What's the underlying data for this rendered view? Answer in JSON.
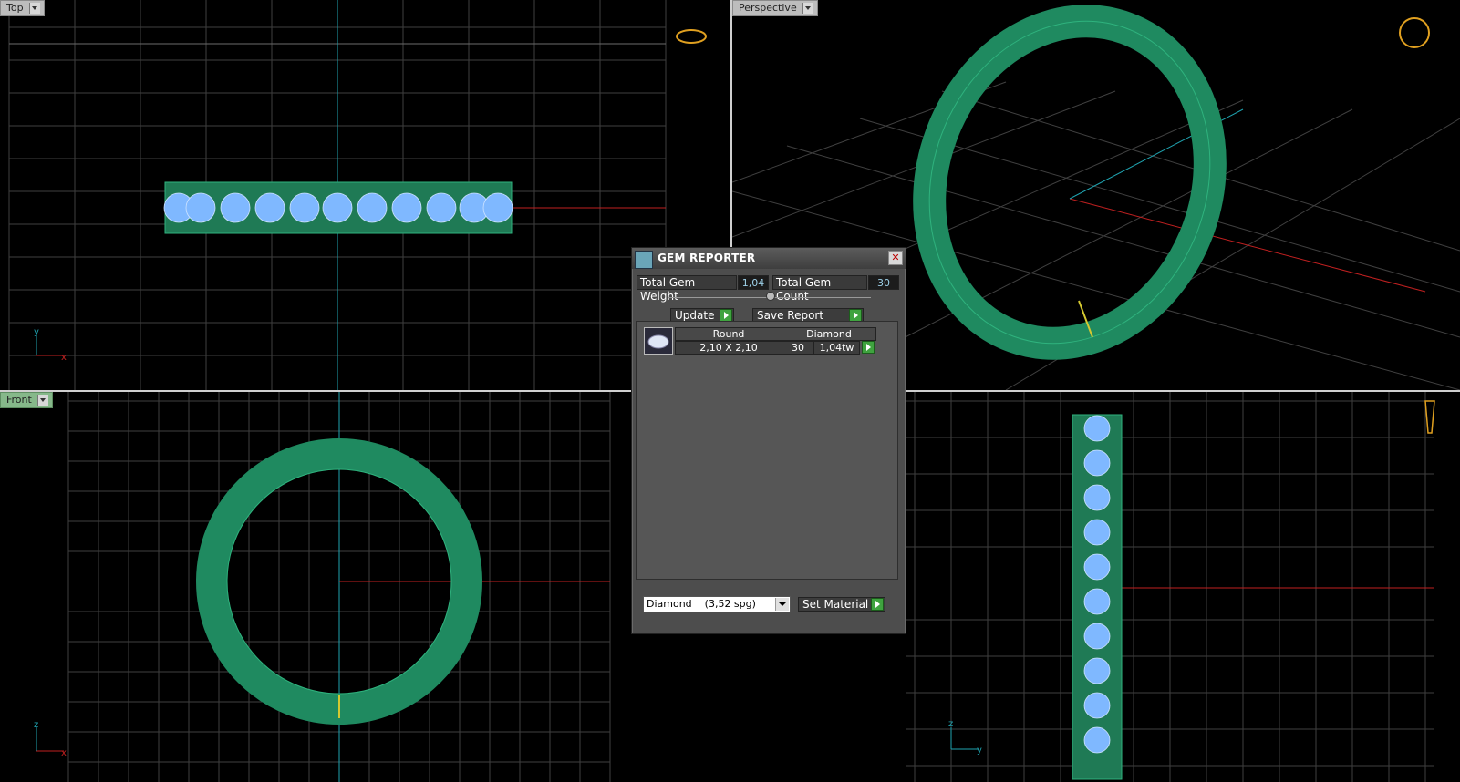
{
  "viewports": {
    "top": {
      "label": "Top",
      "axis_a": "y",
      "axis_b": "x"
    },
    "perspective": {
      "label": "Perspective"
    },
    "front": {
      "label": "Front",
      "axis_a": "z",
      "axis_b": "x"
    },
    "right": {
      "axis_a": "z",
      "axis_b": "y"
    }
  },
  "gem_reporter": {
    "title": "GEM REPORTER",
    "total_weight_label": "Total Gem Weight",
    "total_weight_value": "1,04",
    "total_count_label": "Total Gem Count",
    "total_count_value": "30",
    "update_label": "Update",
    "save_report_label": "Save Report",
    "table": {
      "headers": [
        "Round",
        "Diamond"
      ],
      "row": {
        "size": "2,10 X 2,10",
        "count": "30",
        "weight": "1,04tw"
      }
    },
    "material_select": "Diamond    (3,52 spg)",
    "set_material_label": "Set Material"
  },
  "colors": {
    "ring_green": "#1f8a60",
    "gem_blue": "#7fb8ff",
    "axis_red": "#d02020",
    "axis_cyan": "#1fa3b0",
    "grid": "#444444"
  }
}
